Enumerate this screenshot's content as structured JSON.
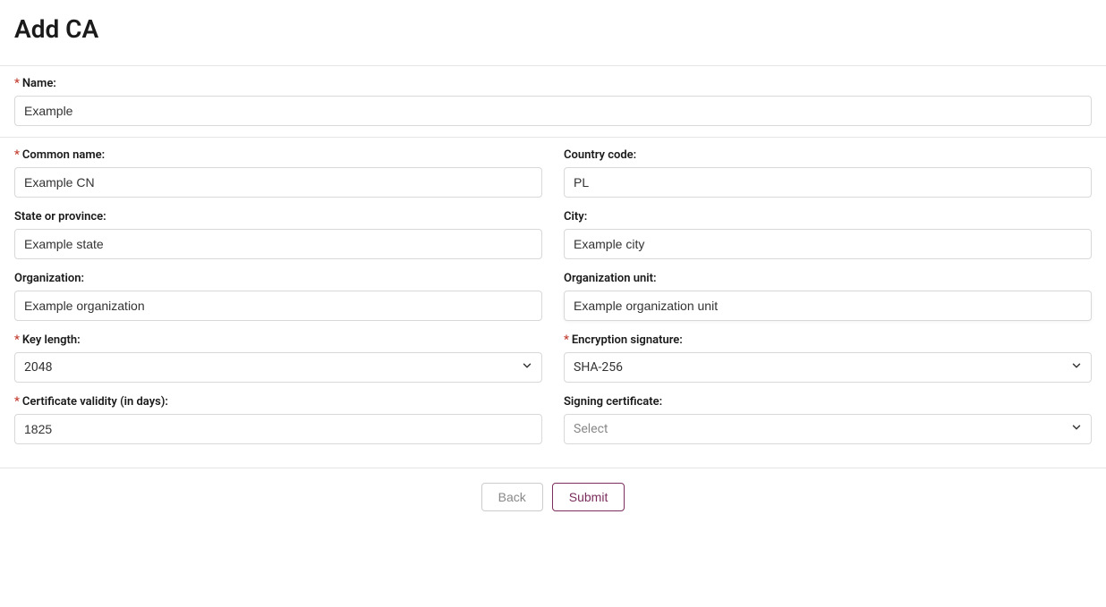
{
  "page": {
    "title": "Add CA"
  },
  "labels": {
    "name": "Name:",
    "common_name": "Common name:",
    "country_code": "Country code:",
    "state": "State or province:",
    "city": "City:",
    "organization": "Organization:",
    "org_unit": "Organization unit:",
    "key_length": "Key length:",
    "enc_sig": "Encryption signature:",
    "cert_validity": "Certificate validity (in days):",
    "signing_cert": "Signing certificate:"
  },
  "values": {
    "name": "Example",
    "common_name": "Example CN",
    "country_code": "PL",
    "state": "Example state",
    "city": "Example city",
    "organization": "Example organization",
    "org_unit": "Example organization unit",
    "key_length": "2048",
    "enc_sig": "SHA-256",
    "cert_validity": "1825",
    "signing_cert": "Select"
  },
  "buttons": {
    "back": "Back",
    "submit": "Submit"
  },
  "required_marker": "*"
}
